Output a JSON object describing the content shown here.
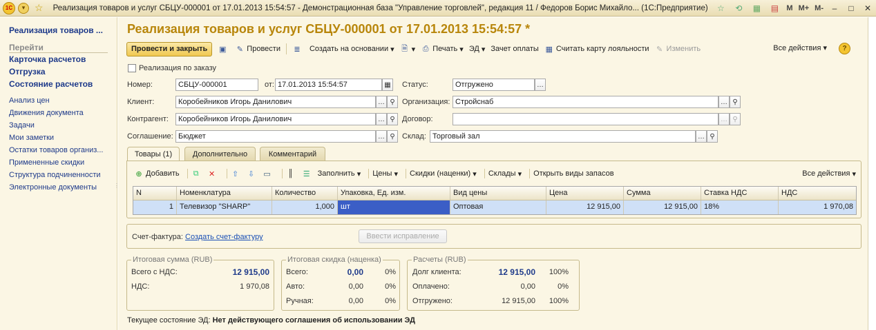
{
  "window": {
    "title": "Реализация товаров и услуг СБЦУ-000001 от 17.01.2013 15:54:57 - Демонстрационная база \"Управление торговлей\", редакция 11 / Федоров Борис Михайло...  (1С:Предприятие)",
    "logo_text": "1С",
    "m_buttons": [
      "M",
      "M+",
      "M-"
    ],
    "icons": [
      "back-forward-icon",
      "star-icon"
    ]
  },
  "leftnav": {
    "title": "Реализация товаров ...",
    "section": "Перейти",
    "bold_items": [
      "Карточка расчетов",
      "Отгрузка",
      "Состояние расчетов"
    ],
    "items": [
      "Анализ цен",
      "Движения документа",
      "Задачи",
      "Мои заметки",
      "Остатки товаров организ...",
      "Примененные скидки",
      "Структура подчиненности",
      "Электронные документы"
    ]
  },
  "form": {
    "title": "Реализация товаров и услуг СБЦУ-000001 от 17.01.2013 15:54:57 *",
    "commands": {
      "post_close": "Провести и закрыть",
      "post": "Провести",
      "create_based": "Создать на основании",
      "print": "Печать",
      "ed": "ЭД",
      "payment_offset": "Зачет оплаты",
      "read_card": "Считать карту лояльности",
      "change": "Изменить",
      "all_actions": "Все действия",
      "help": "?"
    },
    "by_order_label": "Реализация по заказу",
    "fields": {
      "number_label": "Номер:",
      "number": "СБЦУ-000001",
      "from_label": "от:",
      "date": "17.01.2013 15:54:57",
      "status_label": "Статус:",
      "status": "Отгружено",
      "client_label": "Клиент:",
      "client": "Коробейников Игорь Данилович",
      "org_label": "Организация:",
      "org": "Стройснаб",
      "counterparty_label": "Контрагент:",
      "counterparty": "Коробейников Игорь Данилович",
      "contract_label": "Договор:",
      "contract": "",
      "agreement_label": "Соглашение:",
      "agreement": "Бюджет",
      "warehouse_label": "Склад:",
      "warehouse": "Торговый зал"
    },
    "tabs": [
      "Товары (1)",
      "Дополнительно",
      "Комментарий"
    ],
    "table_toolbar": {
      "add": "Добавить",
      "fill": "Заполнить",
      "prices": "Цены",
      "discounts": "Скидки (наценки)",
      "warehouses": "Склады",
      "open_stock_kinds": "Открыть виды запасов",
      "all_actions": "Все действия"
    },
    "table": {
      "headers": [
        "N",
        "Номенклатура",
        "Количество",
        "Упаковка, Ед. изм.",
        "Вид цены",
        "Цена",
        "Сумма",
        "Ставка НДС",
        "НДС"
      ],
      "rows": [
        [
          "1",
          "Телевизор \"SHARP\"",
          "1,000",
          "шт",
          "Оптовая",
          "12 915,00",
          "12 915,00",
          "18%",
          "1 970,08"
        ]
      ]
    },
    "invoice": {
      "label": "Счет-фактура:",
      "link": "Создать счет-фактуру",
      "button": "Ввести исправление"
    },
    "totals": {
      "title": "Итоговая сумма (RUB)",
      "with_vat_label": "Всего с НДС:",
      "with_vat": "12 915,00",
      "vat_label": "НДС:",
      "vat": "1 970,08"
    },
    "discount": {
      "title": "Итоговая скидка (наценка)",
      "rows": [
        {
          "label": "Всего:",
          "value": "0,00",
          "pct": "0%"
        },
        {
          "label": "Авто:",
          "value": "0,00",
          "pct": "0%"
        },
        {
          "label": "Ручная:",
          "value": "0,00",
          "pct": "0%"
        }
      ]
    },
    "settlements": {
      "title": "Расчеты (RUB)",
      "rows": [
        {
          "label": "Долг клиента:",
          "value": "12 915,00",
          "pct": "100%"
        },
        {
          "label": "Оплачено:",
          "value": "0,00",
          "pct": "0%"
        },
        {
          "label": "Отгружено:",
          "value": "12 915,00",
          "pct": "100%"
        }
      ]
    },
    "status_line": {
      "label": "Текущее состояние ЭД:",
      "value": "Нет действующего соглашения об использовании ЭД"
    }
  }
}
